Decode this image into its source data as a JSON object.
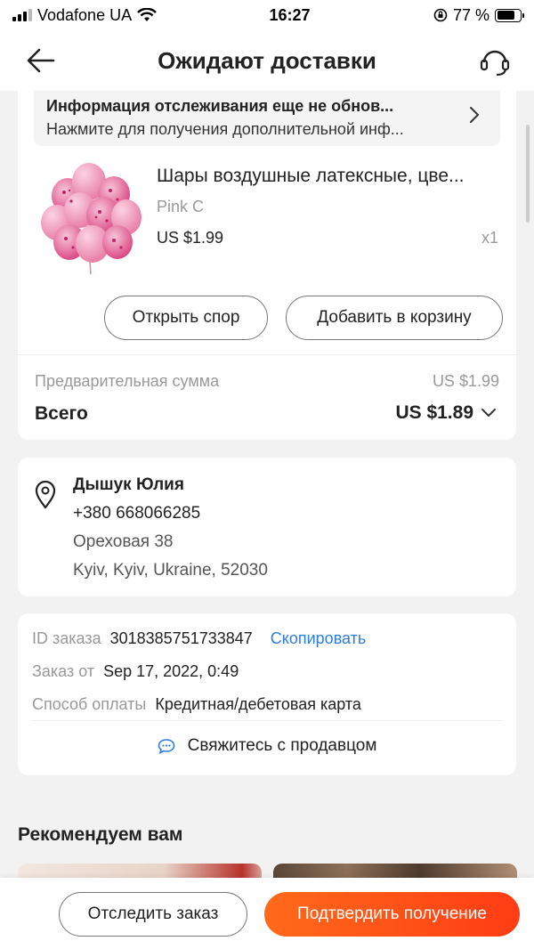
{
  "status_bar": {
    "carrier": "Vodafone UA",
    "time": "16:27",
    "battery_percent": "77 %",
    "battery_level": 0.77
  },
  "header": {
    "title": "Ожидают доставки",
    "back_icon": "arrow-left-icon",
    "support_icon": "headset-icon"
  },
  "tracking": {
    "title": "Информация отслеживания еще не обнов...",
    "subtitle": "Нажмите для получения дополнительной инф..."
  },
  "product": {
    "title": "Шары воздушные латексные, цве...",
    "variant": "Pink C",
    "price": "US $1.99",
    "quantity": "x1"
  },
  "actions": {
    "dispute_label": "Открыть спор",
    "add_cart_label": "Добавить в корзину"
  },
  "summary": {
    "subtotal_label": "Предварительная сумма",
    "subtotal_value": "US $1.99",
    "total_label": "Всего",
    "total_value": "US $1.89"
  },
  "address": {
    "name": "Дышук Юлия",
    "phone": "+380 668066285",
    "street": "Ореховая 38",
    "city": "Kyiv, Kyiv, Ukraine, 52030"
  },
  "order_info": {
    "id_label": "ID заказа",
    "id_value": "3018385751733847",
    "copy_label": "Скопировать",
    "date_label": "Заказ от",
    "date_value": "Sep 17, 2022, 0:49",
    "payment_label": "Способ оплаты",
    "payment_value": "Кредитная/дебетовая карта",
    "contact_label": "Свяжитесь с продавцом"
  },
  "recommend": {
    "title": "Рекомендуем вам"
  },
  "bottom": {
    "track_label": "Отследить заказ",
    "confirm_label": "Подтвердить получение"
  },
  "colors": {
    "accent_orange": "#ff4a17",
    "link_blue": "#2d7de0",
    "balloon_pink": "#f3a6c4"
  }
}
